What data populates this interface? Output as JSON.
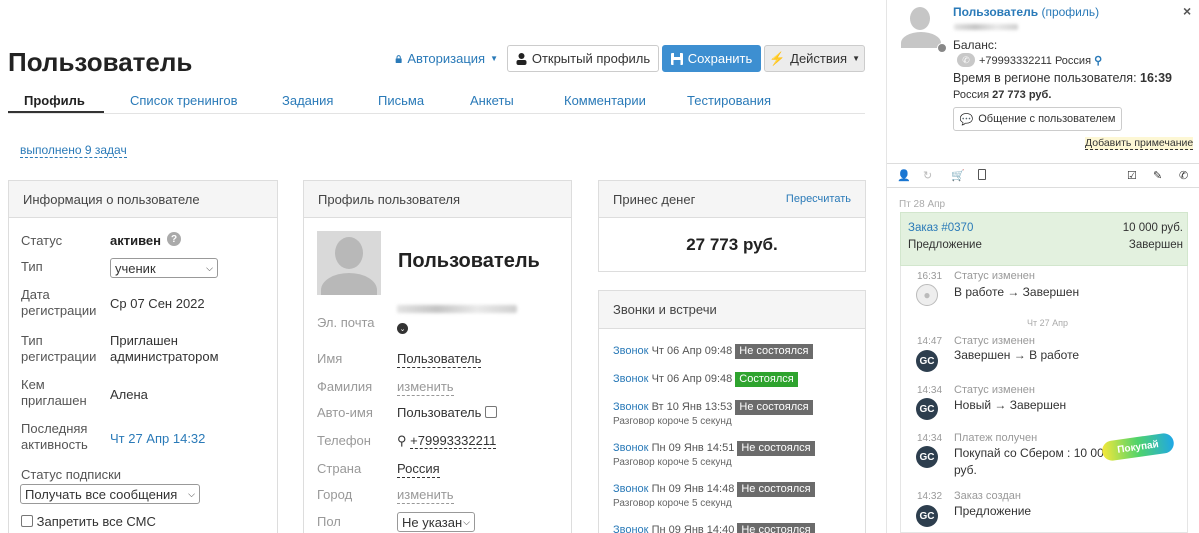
{
  "page": {
    "title": "Пользователь"
  },
  "toolbar": {
    "auth_label": "Авторизация",
    "open_profile_label": "Открытый профиль",
    "save_label": "Сохранить",
    "actions_label": "Действия"
  },
  "tabs": [
    "Профиль",
    "Список тренингов",
    "Задания",
    "Письма",
    "Анкеты",
    "Комментарии",
    "Тестирования"
  ],
  "tasks_link": "выполнено 9 задач",
  "user_info": {
    "title": "Информация о пользователе",
    "status_label": "Статус",
    "status_value": "активен",
    "type_label": "Тип",
    "type_value": "ученик",
    "reg_date_label_1": "Дата",
    "reg_date_label_2": "регистрации",
    "reg_date_value": "Ср 07 Сен 2022",
    "reg_type_label_1": "Тип",
    "reg_type_label_2": "регистрации",
    "reg_type_value_1": "Приглашен",
    "reg_type_value_2": "администратором",
    "invited_label_1": "Кем",
    "invited_label_2": "приглашен",
    "invited_value": "Алена",
    "last_label_1": "Последняя",
    "last_label_2": "активность",
    "last_value": "Чт 27 Апр 14:32",
    "sub_label": "Статус подписки",
    "sub_value": "Получать все сообщения",
    "sms_label": "Запретить все СМС"
  },
  "profile": {
    "title": "Профиль пользователя",
    "name": "Пользователь",
    "email_label": "Эл. почта",
    "first_label": "Имя",
    "first_value": "Пользователь",
    "last_label": "Фамилия",
    "last_value": "изменить",
    "auto_label": "Авто-имя",
    "auto_value": "Пользователь",
    "phone_label": "Телефон",
    "phone_value": "+79993332211",
    "country_label": "Страна",
    "country_value": "Россия",
    "city_label": "Город",
    "city_value": "изменить",
    "gender_label": "Пол",
    "gender_value": "Не указан"
  },
  "money": {
    "title": "Принес денег",
    "recalc": "Пересчитать",
    "value": "27 773 руб."
  },
  "calls": {
    "title": "Звонки и встречи",
    "items": [
      {
        "type": "Звонок",
        "date": "Чт 06 Апр 09:48",
        "status": "Не состоялся",
        "note": ""
      },
      {
        "type": "Звонок",
        "date": "Чт 06 Апр 09:48",
        "status": "Состоялся",
        "note": ""
      },
      {
        "type": "Звонок",
        "date": "Вт 10 Янв 13:53",
        "status": "Не состоялся",
        "note": "Разговор короче 5 секунд"
      },
      {
        "type": "Звонок",
        "date": "Пн 09 Янв 14:51",
        "status": "Не состоялся",
        "note": "Разговор короче 5 секунд"
      },
      {
        "type": "Звонок",
        "date": "Пн 09 Янв 14:48",
        "status": "Не состоялся",
        "note": "Разговор короче 5 секунд"
      },
      {
        "type": "Звонок",
        "date": "Пн 09 Янв 14:40",
        "status": "Не состоялся",
        "note": ""
      }
    ]
  },
  "side": {
    "name": "Пользователь",
    "profile_link": "(профиль)",
    "balance_label": "Баланс:",
    "phone": "+79993332211 Россия",
    "time_label": "Время в регионе пользователя:",
    "time_value": "16:39",
    "country_prefix": "Россия",
    "sum": "27 773 руб.",
    "chat_btn": "Общение с пользователем",
    "add_note": "Добавить примечание",
    "date_1": "Пт 28 Апр",
    "order_label": "Заказ #0370",
    "order_sum": "10 000 руб.",
    "order_type": "Предложение",
    "order_status": "Завершен",
    "date_2": "Чт 27 Апр",
    "promo": "Покупай",
    "events": [
      {
        "time": "16:31",
        "title": "Статус изменен",
        "text": "В работе → Завершен"
      },
      {
        "time": "14:47",
        "title": "Статус изменен",
        "text": "Завершен → В работе"
      },
      {
        "time": "14:34",
        "title": "Статус изменен",
        "text": "Новый → Завершен"
      },
      {
        "time": "14:34",
        "title": "Платеж получен",
        "text": "Покупай со Сбером : 10 000",
        "text2": "руб."
      },
      {
        "time": "14:32",
        "title": "Заказ создан",
        "text": "Предложение"
      }
    ]
  },
  "colors": {
    "accent": "#2a7ab8",
    "save": "#3d8fd1",
    "success": "#2ea32e",
    "failed": "#6b6b6b",
    "order_bg": "#e3f1df"
  }
}
